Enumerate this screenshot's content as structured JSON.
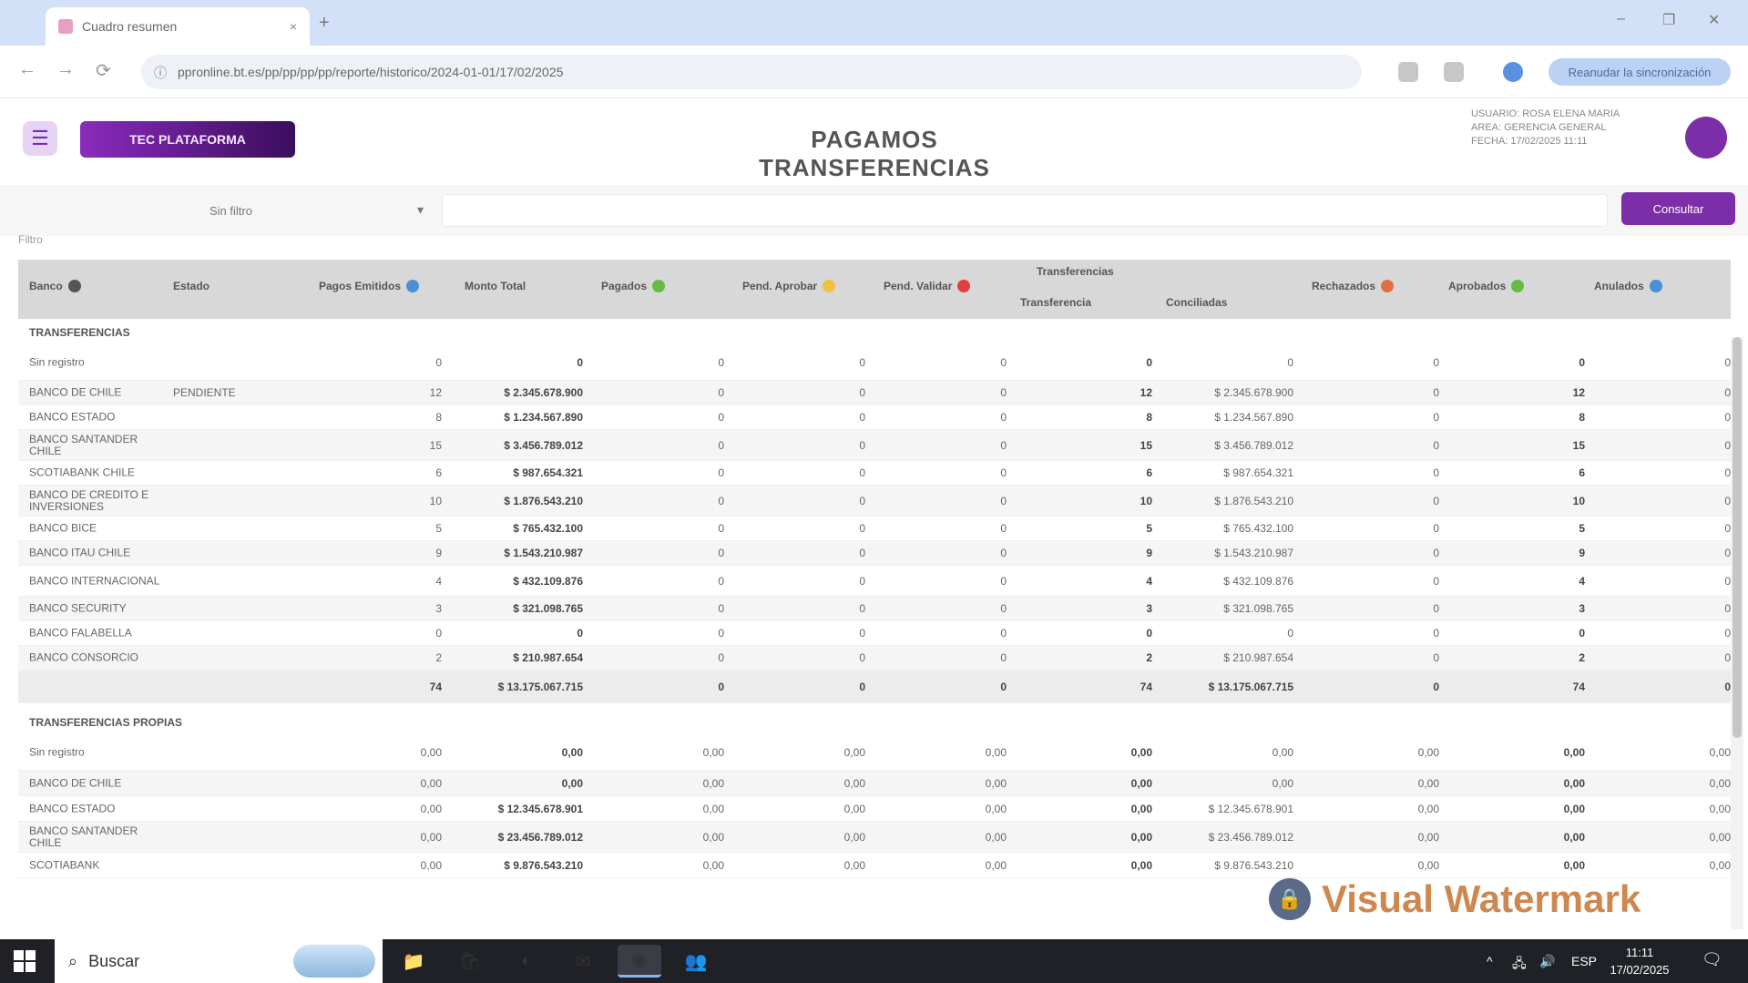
{
  "browser": {
    "tab_title": "Cuadro resumen",
    "new_tab": "+",
    "tab_close": "×",
    "url": "ppronline.bt.es/pp/pp/pp/pp/reporte/historico/2024-01-01/17/02/2025",
    "profile_label": "Reanudar la sincronización",
    "window_controls": [
      "–",
      "❐",
      "✕"
    ],
    "nav": [
      "←",
      "→",
      "⟳"
    ]
  },
  "app": {
    "menu_icon": "☰",
    "brand": "TEC PLATAFORMA",
    "title": "PAGAMOS TRANSFERENCIAS",
    "user_info": [
      "USUARIO: ROSA ELENA MARIA",
      "AREA: GERENCIA GENERAL",
      "FECHA: 17/02/2025 11:11"
    ],
    "filter_select": "Sin filtro",
    "filter_chevron": "▾",
    "filter_button": "Consultar",
    "filter_tag": "Filtro"
  },
  "table": {
    "headers": [
      {
        "label": "Banco",
        "color": "#555555"
      },
      {
        "label": "Estado",
        "color": ""
      },
      {
        "label": "Pagos Emitidos",
        "color": "#4a90d9"
      },
      {
        "label": "Monto Total",
        "color": ""
      },
      {
        "label": "Pagados",
        "color": "#66bb44"
      },
      {
        "label": "Pend. Aprobar",
        "color": "#f0c040"
      },
      {
        "label": "Pend. Validar",
        "color": "#e04040"
      },
      {
        "label": "Rechazados",
        "color": "#e07040"
      },
      {
        "label": "Aprobados",
        "color": "#66bb44"
      },
      {
        "label": "Anulados",
        "color": "#4a90d9"
      }
    ],
    "group_header": "Transferencias",
    "sub_headers": [
      {
        "label": "Transferencia",
        "color": "#4a90d9"
      },
      {
        "label": "Conciliadas",
        "color": "#4a90d9"
      }
    ],
    "section1_title": "TRANSFERENCIAS",
    "section2_title": "TRANSFERENCIAS PROPIAS",
    "section1_rows": [
      [
        "Sin registro",
        "",
        "0",
        "0",
        "0",
        "0",
        "0",
        "0",
        "0",
        "0",
        "0",
        "0"
      ],
      [
        "BANCO DE CHILE",
        "PENDIENTE",
        "12",
        "$ 2.345.678.900",
        "0",
        "0",
        "0",
        "12",
        "$ 2.345.678.900",
        "0",
        "12",
        "0"
      ],
      [
        "BANCO ESTADO",
        "",
        "8",
        "$ 1.234.567.890",
        "0",
        "0",
        "0",
        "8",
        "$ 1.234.567.890",
        "0",
        "8",
        "0"
      ],
      [
        "BANCO SANTANDER CHILE",
        "",
        "15",
        "$ 3.456.789.012",
        "0",
        "0",
        "0",
        "15",
        "$ 3.456.789.012",
        "0",
        "15",
        "0"
      ],
      [
        "SCOTIABANK CHILE",
        "",
        "6",
        "$ 987.654.321",
        "0",
        "0",
        "0",
        "6",
        "$ 987.654.321",
        "0",
        "6",
        "0"
      ],
      [
        "BANCO DE CREDITO E INVERSIONES",
        "",
        "10",
        "$ 1.876.543.210",
        "0",
        "0",
        "0",
        "10",
        "$ 1.876.543.210",
        "0",
        "10",
        "0"
      ],
      [
        "BANCO BICE",
        "",
        "5",
        "$ 765.432.100",
        "0",
        "0",
        "0",
        "5",
        "$ 765.432.100",
        "0",
        "5",
        "0"
      ],
      [
        "BANCO ITAU CHILE",
        "",
        "9",
        "$ 1.543.210.987",
        "0",
        "0",
        "0",
        "9",
        "$ 1.543.210.987",
        "0",
        "9",
        "0"
      ],
      [
        "BANCO INTERNACIONAL",
        "",
        "4",
        "$ 432.109.876",
        "0",
        "0",
        "0",
        "4",
        "$ 432.109.876",
        "0",
        "4",
        "0"
      ],
      [
        "BANCO SECURITY",
        "",
        "3",
        "$ 321.098.765",
        "0",
        "0",
        "0",
        "3",
        "$ 321.098.765",
        "0",
        "3",
        "0"
      ],
      [
        "BANCO FALABELLA",
        "",
        "0",
        "0",
        "0",
        "0",
        "0",
        "0",
        "0",
        "0",
        "0",
        "0"
      ],
      [
        "BANCO CONSORCIO",
        "",
        "2",
        "$ 210.987.654",
        "0",
        "0",
        "0",
        "2",
        "$ 210.987.654",
        "0",
        "2",
        "0"
      ]
    ],
    "section1_total": [
      "",
      "",
      "74",
      "$ 13.175.067.715",
      "0",
      "0",
      "0",
      "74",
      "$ 13.175.067.715",
      "0",
      "74",
      "0"
    ],
    "section2_rows": [
      [
        "Sin registro",
        "",
        "0,00",
        "0,00",
        "0,00",
        "0,00",
        "0,00",
        "0,00",
        "0,00",
        "0,00",
        "0,00",
        "0,00"
      ],
      [
        "BANCO DE CHILE",
        "",
        "0,00",
        "0,00",
        "0,00",
        "0,00",
        "0,00",
        "0,00",
        "0,00",
        "0,00",
        "0,00",
        "0,00"
      ],
      [
        "BANCO ESTADO",
        "",
        "0,00",
        "$ 12.345.678.901",
        "0,00",
        "0,00",
        "0,00",
        "0,00",
        "$ 12.345.678.901",
        "0,00",
        "0,00",
        "0,00"
      ],
      [
        "BANCO SANTANDER CHILE",
        "",
        "0,00",
        "$ 23.456.789.012",
        "0,00",
        "0,00",
        "0,00",
        "0,00",
        "$ 23.456.789.012",
        "0,00",
        "0,00",
        "0,00"
      ],
      [
        "SCOTIABANK",
        "",
        "0,00",
        "$ 9.876.543.210",
        "0,00",
        "0,00",
        "0,00",
        "0,00",
        "$ 9.876.543.210",
        "0,00",
        "0,00",
        "0,00"
      ]
    ]
  },
  "watermark": {
    "text": "Visual Watermark",
    "badge": "🔒"
  },
  "taskbar": {
    "search_placeholder": "Buscar",
    "search_icon": "⌕",
    "apps": [
      {
        "name": "file-explorer-icon",
        "glyph": "📁"
      },
      {
        "name": "store-icon",
        "glyph": "🛍"
      },
      {
        "name": "edge-icon",
        "glyph": "◐"
      },
      {
        "name": "mail-icon",
        "glyph": "✉"
      },
      {
        "name": "chrome-icon",
        "glyph": "◉"
      },
      {
        "name": "teams-icon",
        "glyph": "👥"
      }
    ],
    "tray_chevron": "^",
    "tray_network": "🖧",
    "tray_volume": "🔊",
    "language": "ESP",
    "time": "11:11",
    "date": "17/02/2025",
    "notifications": "🗨"
  }
}
